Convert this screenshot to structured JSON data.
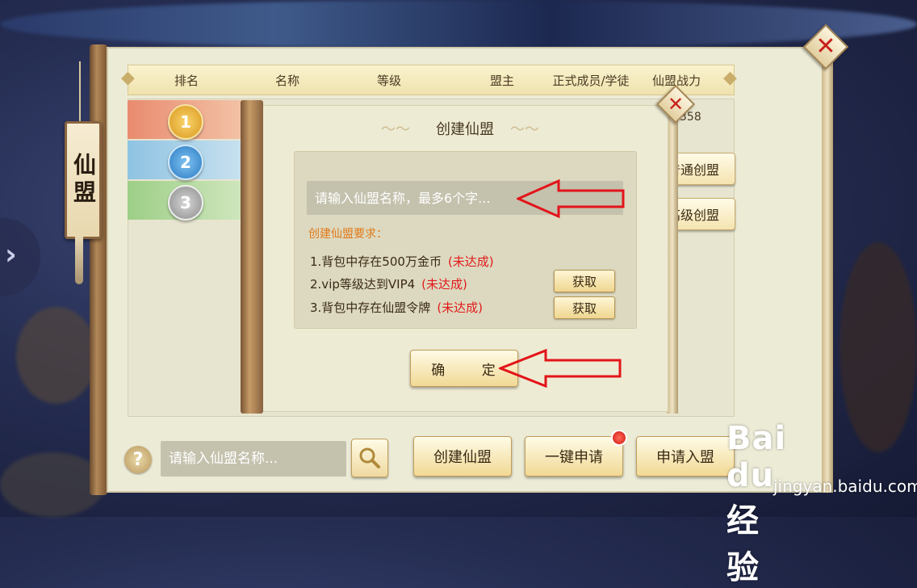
{
  "side_tag": {
    "label": "仙盟"
  },
  "table": {
    "headers": [
      "排名",
      "名称",
      "等级",
      "盟主",
      "正式成员/学徒",
      "仙盟战力"
    ],
    "ranks": [
      "1",
      "2",
      "3"
    ],
    "partial_power_value": "358"
  },
  "side_buttons": {
    "normal_create": "普通创盟",
    "advanced_create": "高级创盟"
  },
  "dialog": {
    "title": "创建仙盟",
    "name_placeholder": "请输入仙盟名称，最多6个字...",
    "requirements_title": "创建仙盟要求：",
    "requirements": [
      {
        "text": "1.背包中存在500万金币",
        "status": "(未达成)"
      },
      {
        "text": "2.vip等级达到VIP4",
        "status": "(未达成)"
      },
      {
        "text": "3.背包中存在仙盟令牌",
        "status": "(未达成)"
      }
    ],
    "get_label": "获取",
    "confirm_label": "确 定"
  },
  "bottom": {
    "help_label": "?",
    "search_placeholder": "请输入仙盟名称...",
    "create_label": "创建仙盟",
    "quick_apply_label": "一键申请",
    "apply_label": "申请入盟"
  },
  "colors": {
    "accent_red": "#e01a1a",
    "requirement_orange": "#e07a1a",
    "arrow_red": "#e3141a"
  },
  "watermark": {
    "logo": "Bai du 经验",
    "sub": "jingyan.baidu.com"
  }
}
